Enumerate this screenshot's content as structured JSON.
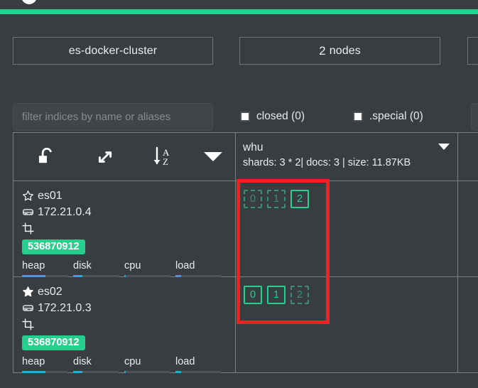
{
  "app": {
    "accent_green": "#25cf8d",
    "background": "#373d40",
    "annotation_color": "#f42020"
  },
  "header": {
    "cluster_name": "es-docker-cluster",
    "nodes_count": "2",
    "nodes_label": "nodes",
    "filter_placeholder": "filter indices by name or aliases",
    "checkboxes": [
      {
        "label": "closed (0)",
        "checked": false
      },
      {
        "label": ".special (0)",
        "checked": false
      }
    ]
  },
  "toolbar": {
    "icons": [
      {
        "name": "unlock-icon",
        "title": "unlock"
      },
      {
        "name": "expand-icon",
        "title": "expand"
      },
      {
        "name": "sort-az-icon",
        "title": "sort A-Z"
      },
      {
        "name": "caret-down-icon",
        "title": "more"
      }
    ]
  },
  "index": {
    "name": "whu",
    "meta": "shards: 3 * 2| docs: 3 | size: 11.87KB"
  },
  "nodes": [
    {
      "name": "es01",
      "ip": "172.21.0.4",
      "master": false,
      "star_icon": "star-outline-icon",
      "disk_icon": "disk-icon",
      "transform_icon": "crop-icon",
      "memory": "536870912",
      "metrics": [
        {
          "label": "heap",
          "percent": 52
        },
        {
          "label": "disk",
          "percent": 20
        },
        {
          "label": "cpu",
          "percent": 3
        },
        {
          "label": "load",
          "percent": 13
        }
      ],
      "shards": [
        {
          "label": "0",
          "type": "replica"
        },
        {
          "label": "1",
          "type": "replica"
        },
        {
          "label": "2",
          "type": "primary"
        }
      ]
    },
    {
      "name": "es02",
      "ip": "172.21.0.3",
      "master": true,
      "star_icon": "star-filled-icon",
      "disk_icon": "disk-icon",
      "transform_icon": "crop-icon",
      "memory": "536870912",
      "metrics": [
        {
          "label": "heap",
          "percent": 52
        },
        {
          "label": "disk",
          "percent": 20
        },
        {
          "label": "cpu",
          "percent": 3
        },
        {
          "label": "load",
          "percent": 13
        }
      ],
      "shards": [
        {
          "label": "0",
          "type": "primary"
        },
        {
          "label": "1",
          "type": "primary"
        },
        {
          "label": "2",
          "type": "replica"
        }
      ]
    }
  ]
}
